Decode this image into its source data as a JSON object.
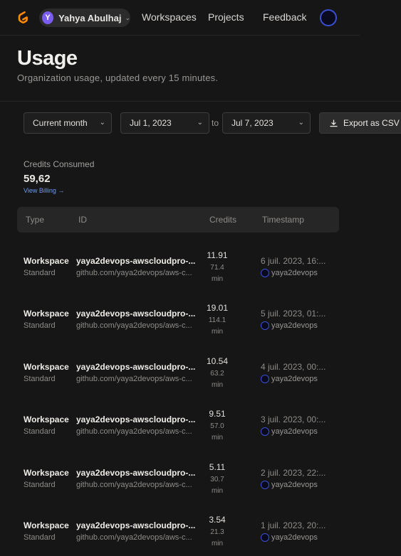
{
  "nav": {
    "org_initial": "Y",
    "org_name": "Yahya Abulhaj",
    "workspaces": "Workspaces",
    "projects": "Projects",
    "feedback": "Feedback",
    "brand_color": "#ff8a00"
  },
  "header": {
    "title": "Usage",
    "subtitle": "Organization usage, updated every 15 minutes."
  },
  "filters": {
    "range": "Current month",
    "from": "Jul 1, 2023",
    "to_label": "to",
    "to": "Jul 7, 2023",
    "export": "Export as CSV"
  },
  "summary": {
    "label": "Credits Consumed",
    "value": "59,62",
    "billing_link": "View Billing →"
  },
  "table": {
    "headers": [
      "Type",
      "ID",
      "Credits",
      "Timestamp"
    ],
    "rows": [
      {
        "type": "Workspace",
        "sub": "Standard",
        "id": "yaya2devops-awscloudpro-...",
        "repo": "github.com/yaya2devops/aws-c...",
        "credits": "11.91",
        "mins": "71.4",
        "unit": "min",
        "ts": "6 juil. 2023, 16:...",
        "user": "yaya2devops"
      },
      {
        "type": "Workspace",
        "sub": "Standard",
        "id": "yaya2devops-awscloudpro-...",
        "repo": "github.com/yaya2devops/aws-c...",
        "credits": "19.01",
        "mins": "114.1",
        "unit": "min",
        "ts": "5 juil. 2023, 01:...",
        "user": "yaya2devops"
      },
      {
        "type": "Workspace",
        "sub": "Standard",
        "id": "yaya2devops-awscloudpro-...",
        "repo": "github.com/yaya2devops/aws-c...",
        "credits": "10.54",
        "mins": "63.2",
        "unit": "min",
        "ts": "4 juil. 2023, 00:...",
        "user": "yaya2devops"
      },
      {
        "type": "Workspace",
        "sub": "Standard",
        "id": "yaya2devops-awscloudpro-...",
        "repo": "github.com/yaya2devops/aws-c...",
        "credits": "9.51",
        "mins": "57.0",
        "unit": "min",
        "ts": "3 juil. 2023, 00:...",
        "user": "yaya2devops"
      },
      {
        "type": "Workspace",
        "sub": "Standard",
        "id": "yaya2devops-awscloudpro-...",
        "repo": "github.com/yaya2devops/aws-c...",
        "credits": "5.11",
        "mins": "30.7",
        "unit": "min",
        "ts": "2 juil. 2023, 22:...",
        "user": "yaya2devops"
      },
      {
        "type": "Workspace",
        "sub": "Standard",
        "id": "yaya2devops-awscloudpro-...",
        "repo": "github.com/yaya2devops/aws-c...",
        "credits": "3.54",
        "mins": "21.3",
        "unit": "min",
        "ts": "1 juil. 2023, 20:...",
        "user": "yaya2devops"
      }
    ]
  }
}
